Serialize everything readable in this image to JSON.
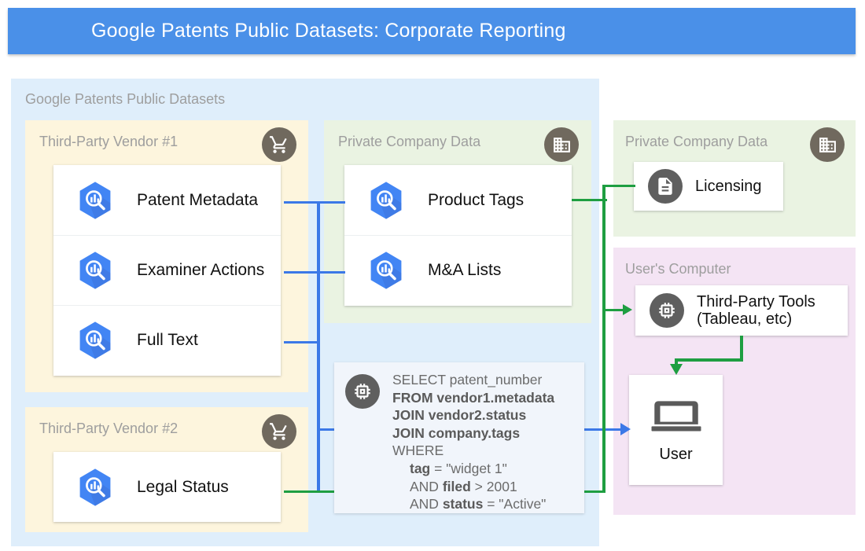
{
  "header": {
    "title": "Google Patents Public Datasets: Corporate Reporting",
    "bg_color": "#4a90e8",
    "text_color": "#ffffff"
  },
  "containers": {
    "gpd": {
      "label": "Google Patents Public Datasets",
      "bg_color": "#dfeefb"
    },
    "vendor1": {
      "label": "Third-Party Vendor #1",
      "bg_color": "#fdf5dd",
      "badge_icon": "shopping-cart-icon"
    },
    "vendor2": {
      "label": "Third-Party Vendor #2",
      "bg_color": "#fdf5dd",
      "badge_icon": "shopping-cart-icon"
    },
    "private_mid": {
      "label": "Private Company Data",
      "bg_color": "#eaf3e2",
      "badge_icon": "office-building-icon"
    },
    "private_right": {
      "label": "Private Company Data",
      "bg_color": "#eaf3e2",
      "badge_icon": "office-building-icon"
    },
    "users_computer": {
      "label": "User's Computer",
      "bg_color": "#f4e4f4"
    }
  },
  "datasets": {
    "vendor1_items": [
      {
        "label": "Patent Metadata",
        "icon": "bigquery-icon"
      },
      {
        "label": "Examiner Actions",
        "icon": "bigquery-icon"
      },
      {
        "label": "Full Text",
        "icon": "bigquery-icon"
      }
    ],
    "vendor2_items": [
      {
        "label": "Legal Status",
        "icon": "bigquery-icon"
      }
    ],
    "private_mid_items": [
      {
        "label": "Product Tags",
        "icon": "bigquery-icon"
      },
      {
        "label": "M&A Lists",
        "icon": "bigquery-icon"
      }
    ]
  },
  "nodes": {
    "licensing": {
      "label": "Licensing",
      "icon": "document-icon"
    },
    "third_party_tools": {
      "line1": "Third-Party Tools",
      "line2": "(Tableau, etc)",
      "icon": "chip-icon"
    },
    "user": {
      "label": "User",
      "icon": "laptop-icon"
    }
  },
  "sql": {
    "icon": "chip-icon",
    "lines": [
      {
        "text": "SELECT patent_number",
        "bold": false,
        "indent": 0
      },
      {
        "text": "FROM vendor1.metadata",
        "bold": true,
        "indent": 0
      },
      {
        "text": "JOIN vendor2.status",
        "bold": true,
        "indent": 0
      },
      {
        "text": "JOIN company.tags",
        "bold": true,
        "indent": 0
      },
      {
        "text": "WHERE",
        "bold": false,
        "indent": 0
      },
      {
        "text": "tag = \"widget 1\"",
        "bold_prefix": "tag",
        "rest": " = \"widget 1\"",
        "indent": 1
      },
      {
        "text": "AND filed > 2001",
        "prefix": "AND ",
        "bold_prefix": "filed",
        "rest": " > 2001",
        "indent": 1
      },
      {
        "text": "AND status = \"Active\"",
        "prefix": "AND ",
        "bold_prefix": "status",
        "rest": " = \"Active\"",
        "indent": 1
      }
    ]
  },
  "connector_colors": {
    "blue": "#3b78e7",
    "green": "#1e9e41"
  }
}
